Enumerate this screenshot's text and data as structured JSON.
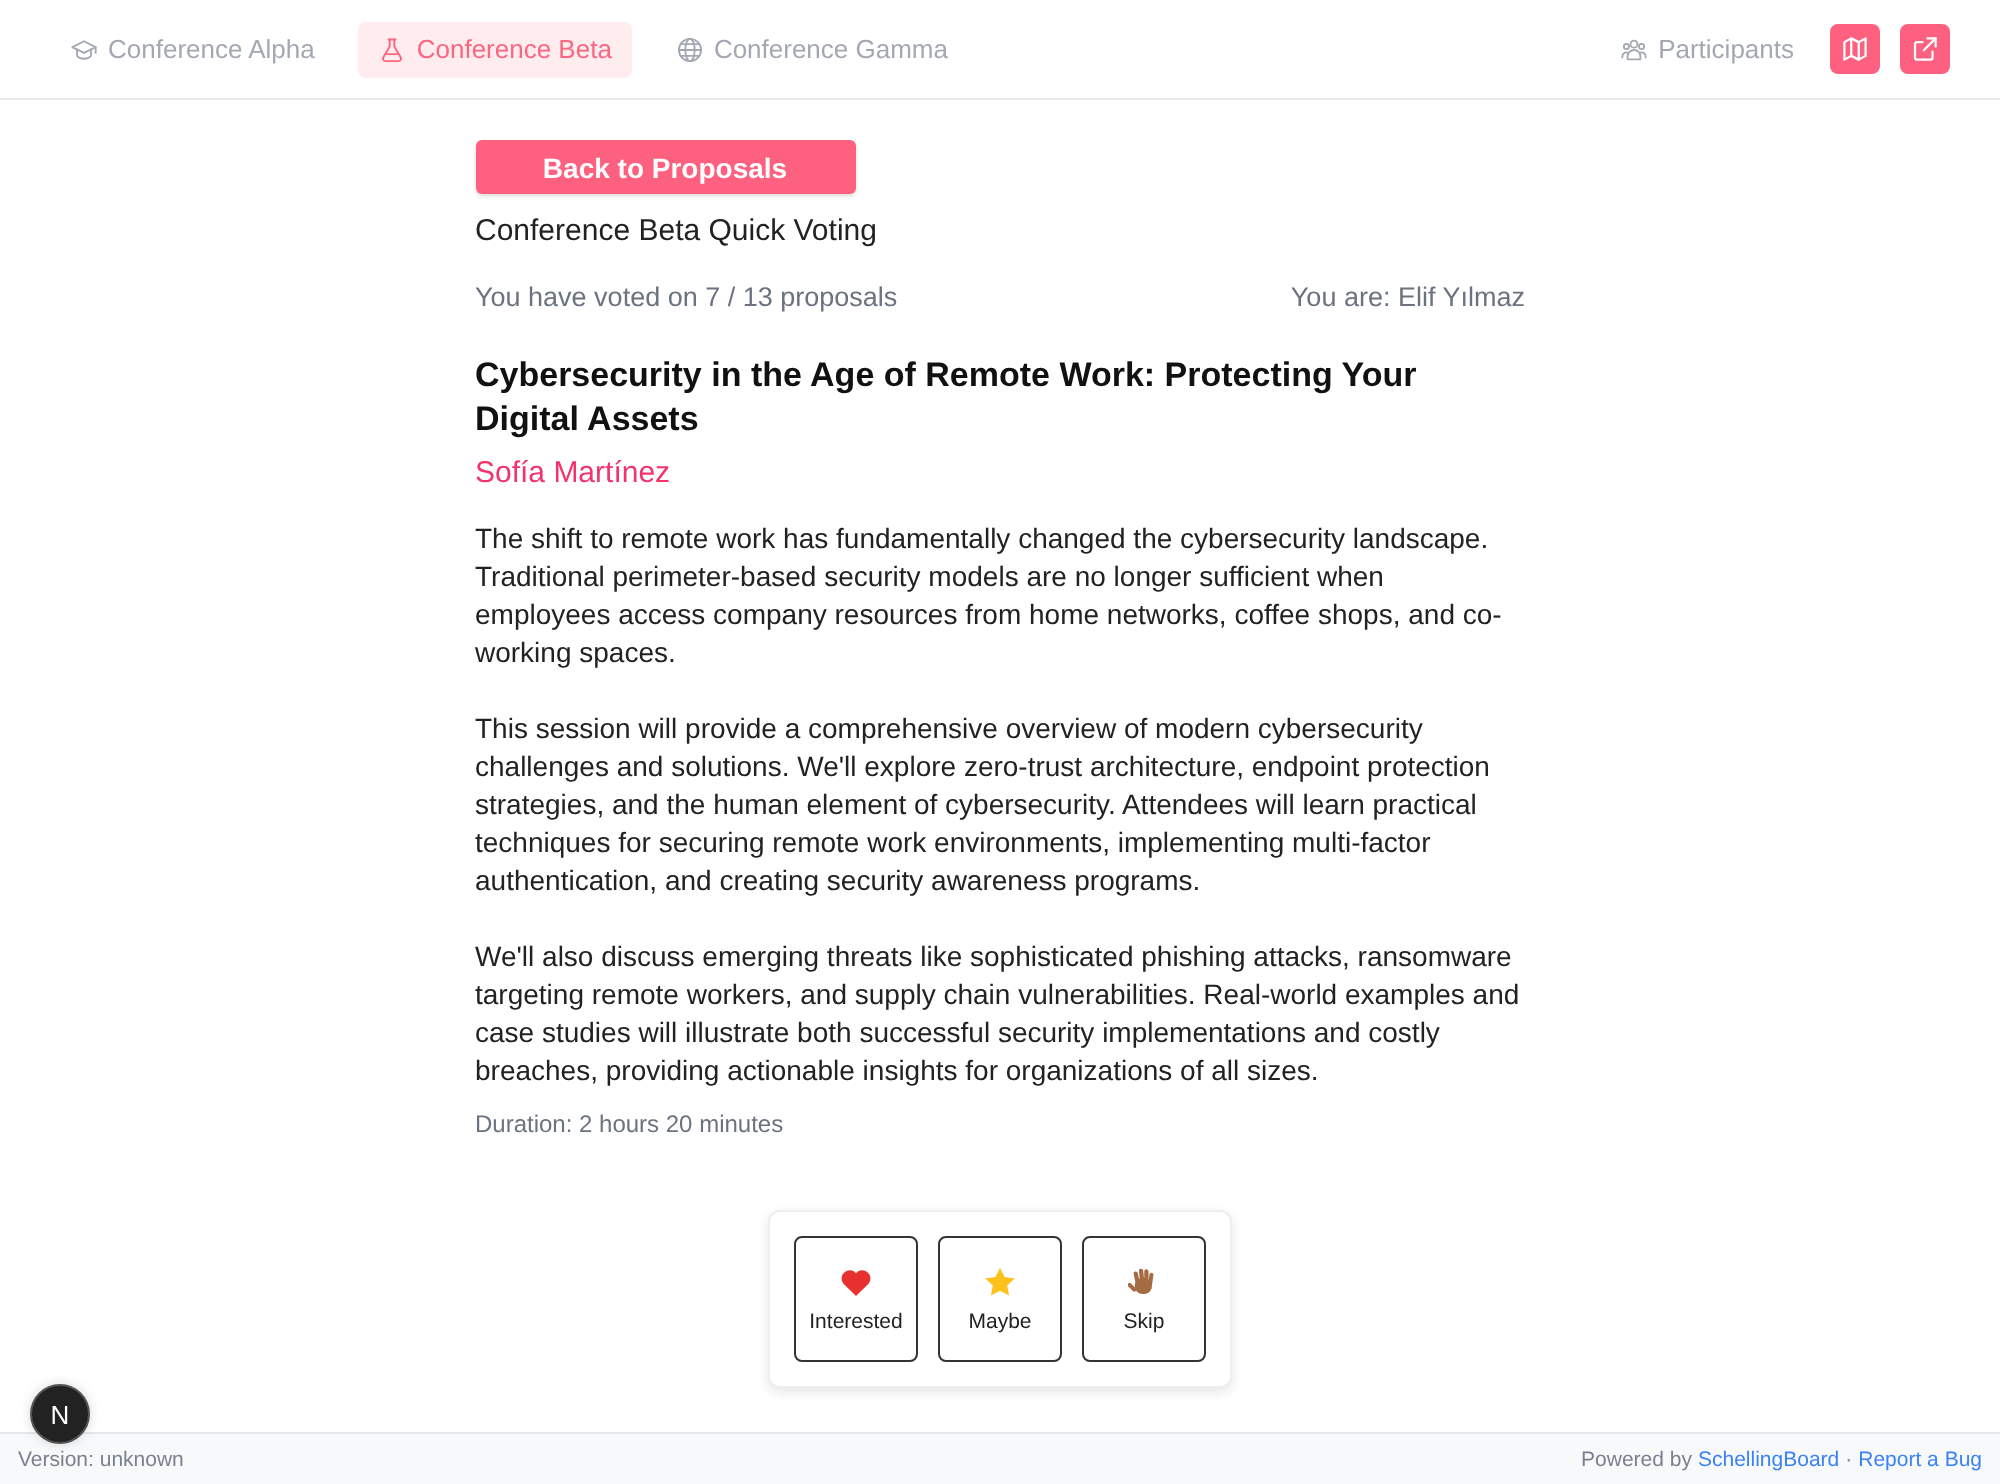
{
  "nav": {
    "tabs": [
      {
        "label": "Conference Alpha",
        "selected": false
      },
      {
        "label": "Conference Beta",
        "selected": true
      },
      {
        "label": "Conference Gamma",
        "selected": false
      }
    ],
    "participants_link": "Participants"
  },
  "page": {
    "back_button": "Back to Proposals",
    "heading": "Conference Beta Quick Voting",
    "progress": "You have voted on 7 / 13 proposals",
    "current_user": "You are: Elif Yılmaz"
  },
  "proposal": {
    "title": "Cybersecurity in the Age of Remote Work: Protecting Your Digital Assets",
    "speaker": "Sofía Martínez",
    "description": [
      "The shift to remote work has fundamentally changed the cybersecurity landscape. Traditional perimeter-based security models are no longer sufficient when employees access company resources from home networks, coffee shops, and co-working spaces.",
      "This session will provide a comprehensive overview of modern cybersecurity challenges and solutions. We'll explore zero-trust architecture, endpoint protection strategies, and the human element of cybersecurity. Attendees will learn practical techniques for securing remote work environments, implementing multi-factor authentication, and creating security awareness programs.",
      "We'll also discuss emerging threats like sophisticated phishing attacks, ransomware targeting remote workers, and supply chain vulnerabilities. Real-world examples and case studies will illustrate both successful security implementations and costly breaches, providing actionable insights for organizations of all sizes."
    ],
    "duration": "Duration: 2 hours 20 minutes"
  },
  "vote_options": [
    {
      "label": "Interested",
      "kind": "interested"
    },
    {
      "label": "Maybe",
      "kind": "maybe"
    },
    {
      "label": "Skip",
      "kind": "skip"
    }
  ],
  "dev_badge": "N",
  "footer": {
    "version": "Version: unknown",
    "powered_by": "Powered by",
    "brand_link": "SchellingBoard",
    "separator": "·",
    "report_link": "Report a Bug"
  }
}
